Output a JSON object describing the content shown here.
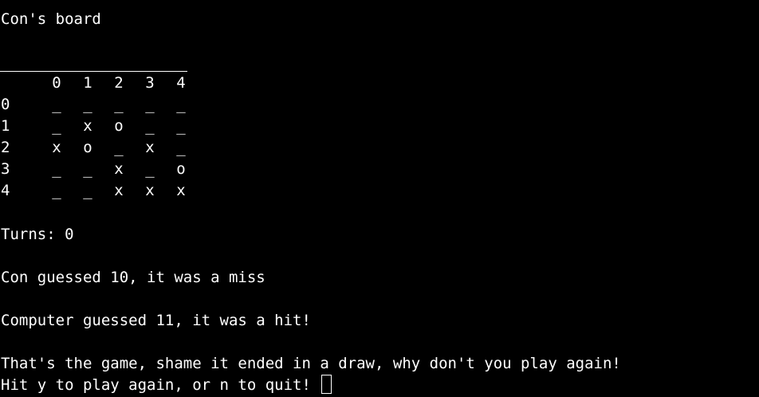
{
  "board_title": "Con's board",
  "columns": [
    "0",
    "1",
    "2",
    "3",
    "4"
  ],
  "rows": [
    {
      "label": "0",
      "cells": [
        "_",
        "_",
        "_",
        "_",
        "_"
      ]
    },
    {
      "label": "1",
      "cells": [
        "_",
        "x",
        "o",
        "_",
        "_"
      ]
    },
    {
      "label": "2",
      "cells": [
        "x",
        "o",
        "_",
        "x",
        "_"
      ]
    },
    {
      "label": "3",
      "cells": [
        "_",
        "_",
        "x",
        "_",
        "o"
      ]
    },
    {
      "label": "4",
      "cells": [
        "_",
        "_",
        "x",
        "x",
        "x"
      ]
    }
  ],
  "turns_text": "Turns: 0",
  "player_guess_text": "Con guessed 10, it was a miss",
  "computer_guess_text": "Computer guessed 11, it was a hit!",
  "result_text": "That's the game, shame it ended in a draw, why don't you play again!",
  "prompt_text": "Hit y to play again, or n to quit! "
}
